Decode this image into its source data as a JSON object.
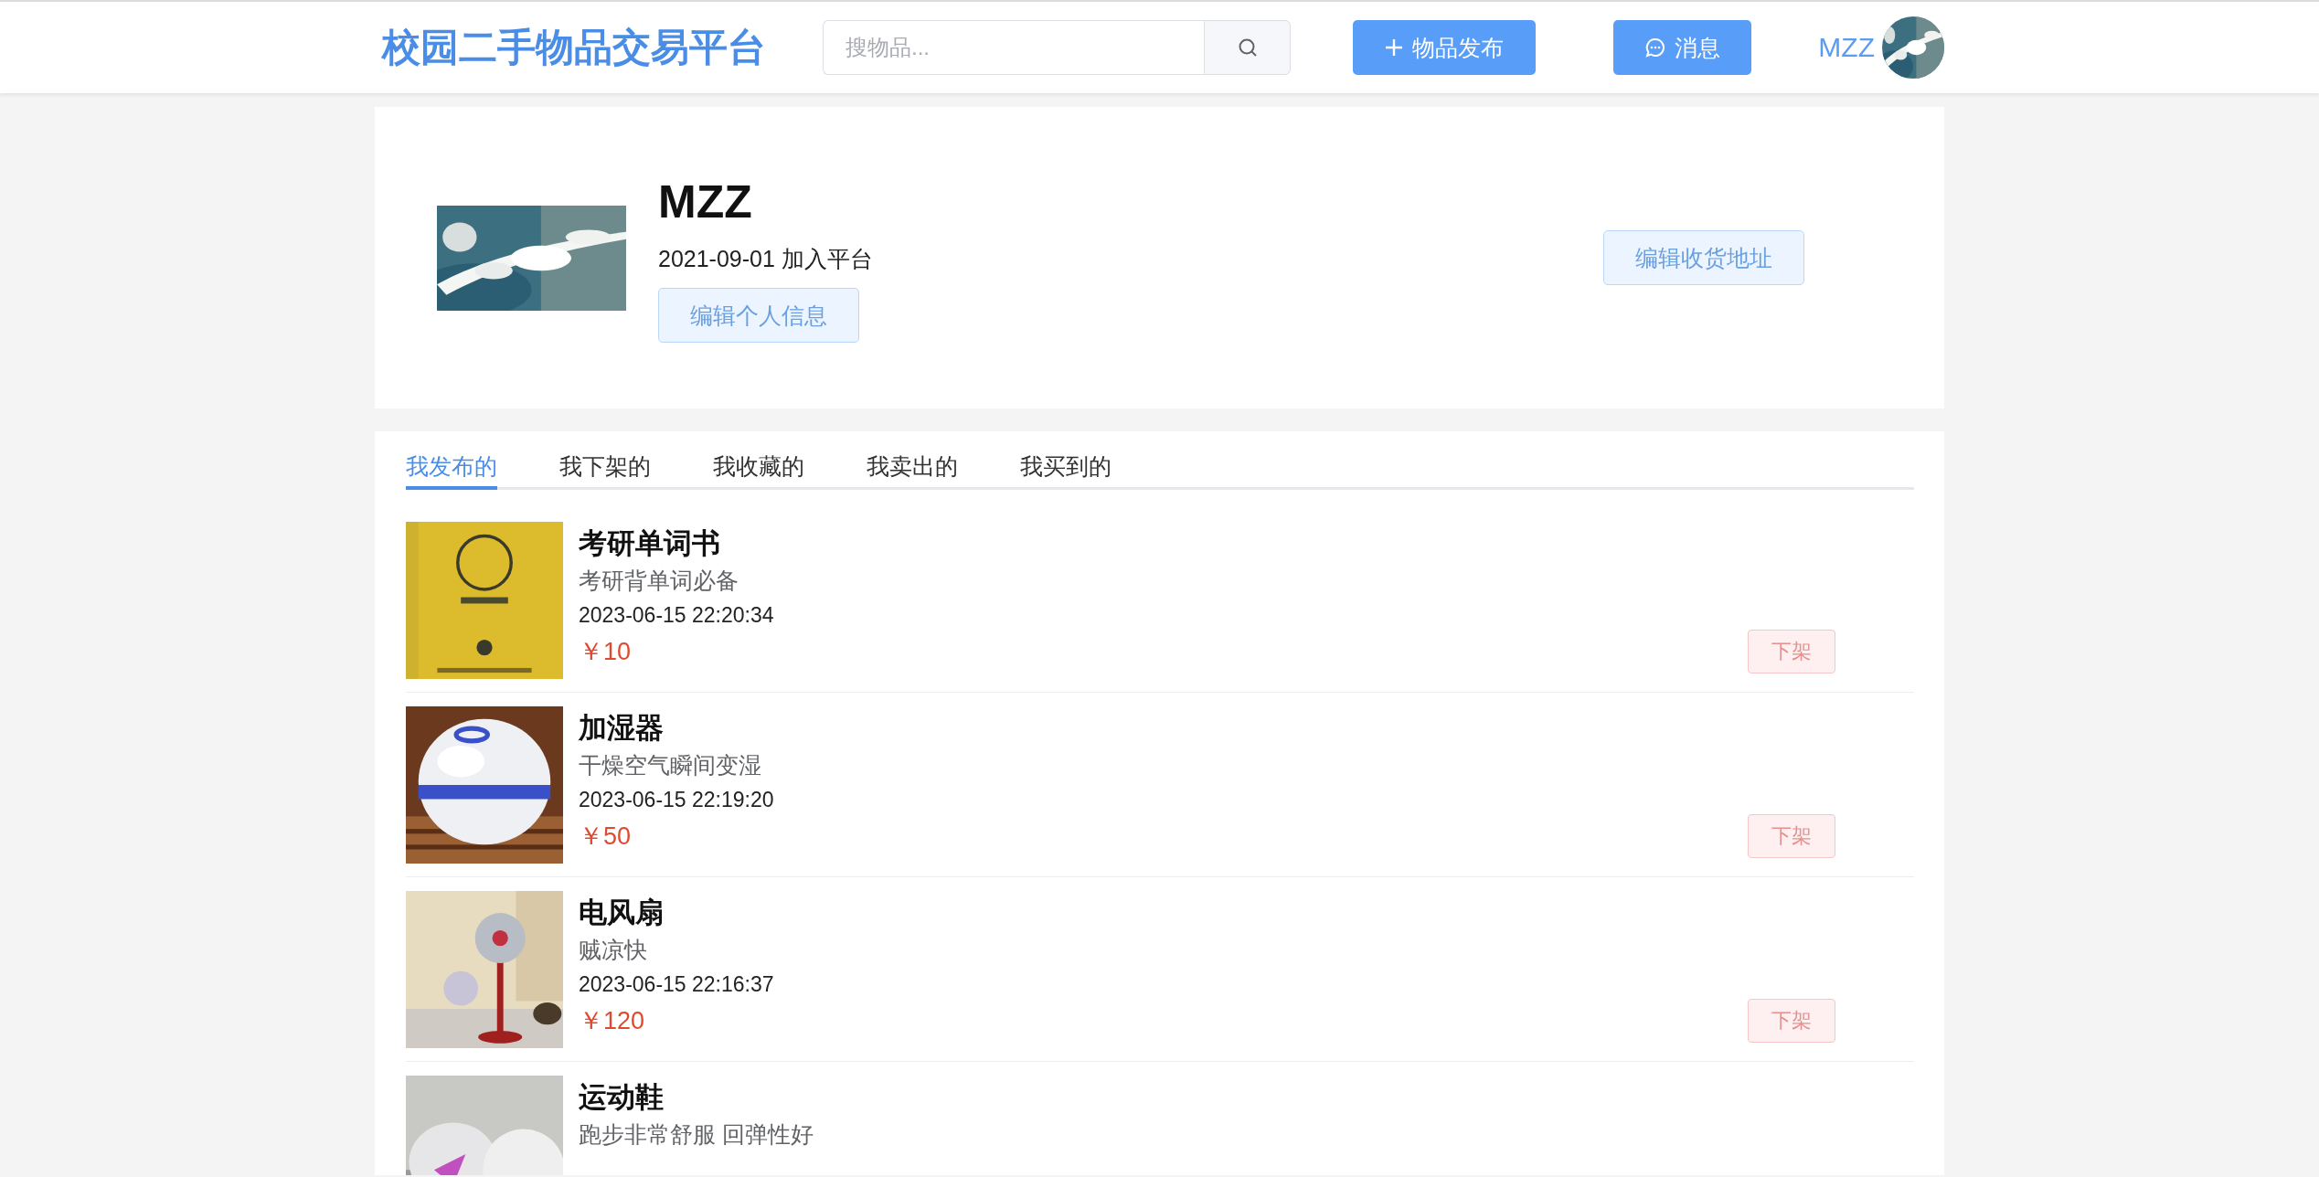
{
  "header": {
    "logo": "校园二手物品交易平台",
    "search": {
      "placeholder": "搜物品..."
    },
    "publish_button": "物品发布",
    "message_button": "消息",
    "username": "MZZ"
  },
  "profile": {
    "name": "MZZ",
    "joined": "2021-09-01 加入平台",
    "edit_button": "编辑个人信息",
    "address_button": "编辑收货地址"
  },
  "tabs": [
    {
      "label": "我发布的",
      "selected": true
    },
    {
      "label": "我下架的",
      "selected": false
    },
    {
      "label": "我收藏的",
      "selected": false
    },
    {
      "label": "我卖出的",
      "selected": false
    },
    {
      "label": "我买到的",
      "selected": false
    }
  ],
  "items": [
    {
      "title": "考研单词书",
      "description": "考研背单词必备",
      "time": "2023-06-15 22:20:34",
      "price": "￥10",
      "action": "下架"
    },
    {
      "title": "加湿器",
      "description": "干燥空气瞬间变湿",
      "time": "2023-06-15 22:19:20",
      "price": "￥50",
      "action": "下架"
    },
    {
      "title": "电风扇",
      "description": "贼凉快",
      "time": "2023-06-15 22:16:37",
      "price": "￥120",
      "action": "下架"
    },
    {
      "title": "运动鞋",
      "description": "跑步非常舒服 回弹性好"
    }
  ]
}
